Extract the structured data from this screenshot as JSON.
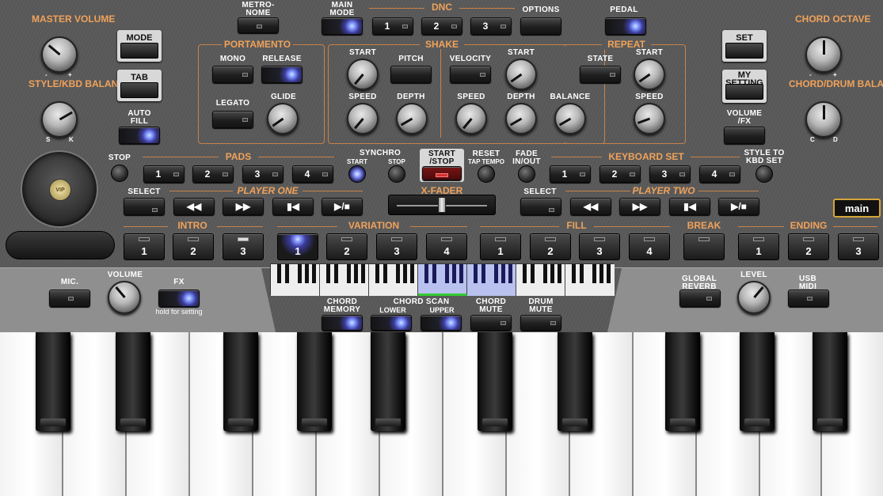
{
  "top": {
    "metronome": "METRO-\nNOME",
    "main_mode": "MAIN\nMODE",
    "dnc": "DNC",
    "dnc_buttons": [
      "1",
      "2",
      "3"
    ],
    "options": "OPTIONS",
    "pedal": "PEDAL"
  },
  "left": {
    "master_volume": "MASTER\nVOLUME",
    "style_kbd_balance": "STYLE/KBD\nBALANCE",
    "mode": "MODE",
    "tab": "TAB",
    "auto_fill": "AUTO\nFILL",
    "knob_min": "-",
    "knob_max": "+",
    "bal_s": "S",
    "bal_k": "K",
    "vip": "VIP"
  },
  "right": {
    "chord_octave": "CHORD\nOCTAVE",
    "chord_drum_balance": "CHORD/DRUM\nBALANCE",
    "set": "SET",
    "my_setting": "MY\nSETTING",
    "volume_fx": "VOLUME\n/FX",
    "oct_min": "-",
    "oct_max": "+",
    "bal_c": "C",
    "bal_d": "D"
  },
  "portamento": {
    "title": "PORTAMENTO",
    "mono": "MONO",
    "release": "RELEASE",
    "legato": "LEGATO",
    "glide": "GLIDE"
  },
  "shake": {
    "title": "SHAKE",
    "start": "START",
    "pitch": "PITCH",
    "speed": "SPEED",
    "depth": "DEPTH",
    "velocity": "VELOCITY",
    "start2": "START",
    "speed2": "SPEED",
    "depth2": "DEPTH",
    "balance": "BALANCE"
  },
  "repeat": {
    "title": "REPEAT",
    "state": "STATE",
    "start": "START",
    "speed": "SPEED"
  },
  "pads": {
    "stop": "STOP",
    "title": "PADS",
    "buttons": [
      "1",
      "2",
      "3",
      "4"
    ]
  },
  "synchro": {
    "title": "SYNCHRO",
    "start": "START",
    "stop": "STOP"
  },
  "transport": {
    "start_stop": "START\n/STOP",
    "reset": "RESET",
    "tap_tempo": "TAP TEMPO",
    "fade": "FADE\nIN/OUT"
  },
  "keyboard_set": {
    "title": "KEYBOARD SET",
    "buttons": [
      "1",
      "2",
      "3",
      "4"
    ],
    "style_to_kbd": "STYLE TO\nKBD SET"
  },
  "player_one": {
    "select": "SELECT",
    "title": "PLAYER ONE"
  },
  "player_two": {
    "select": "SELECT",
    "title": "PLAYER TWO"
  },
  "xfader": "X-FADER",
  "main_button": "main",
  "sections": {
    "intro": "INTRO",
    "variation": "VARIATION",
    "fill": "FILL",
    "break": "BREAK",
    "ending": "ENDING",
    "intro_buttons": [
      "1",
      "2",
      "3"
    ],
    "variation_buttons": [
      "1",
      "2",
      "3",
      "4"
    ],
    "fill_buttons": [
      "1",
      "2",
      "3",
      "4"
    ],
    "ending_buttons": [
      "1",
      "2",
      "3"
    ]
  },
  "mic": {
    "mic": "MIC.",
    "volume": "VOLUME",
    "fx": "FX",
    "hold": "hold for\nsetting"
  },
  "global": {
    "global_reverb": "GLOBAL\nREVERB",
    "level": "LEVEL",
    "usb_midi": "USB\nMIDI"
  },
  "chord": {
    "memory": "CHORD\nMEMORY",
    "scan": "CHORD SCAN",
    "lower": "LOWER",
    "upper": "UPPER",
    "mute": "CHORD\nMUTE",
    "drum_mute": "DRUM\nMUTE"
  },
  "glyphs": {
    "rewind": "◀◀",
    "forward": "▶▶",
    "prev": "▮◀",
    "playpause": "▶/■"
  },
  "colors": {
    "accent": "#f0a25a",
    "led_blue": "#8294ff",
    "panel": "#5a5a5a"
  }
}
